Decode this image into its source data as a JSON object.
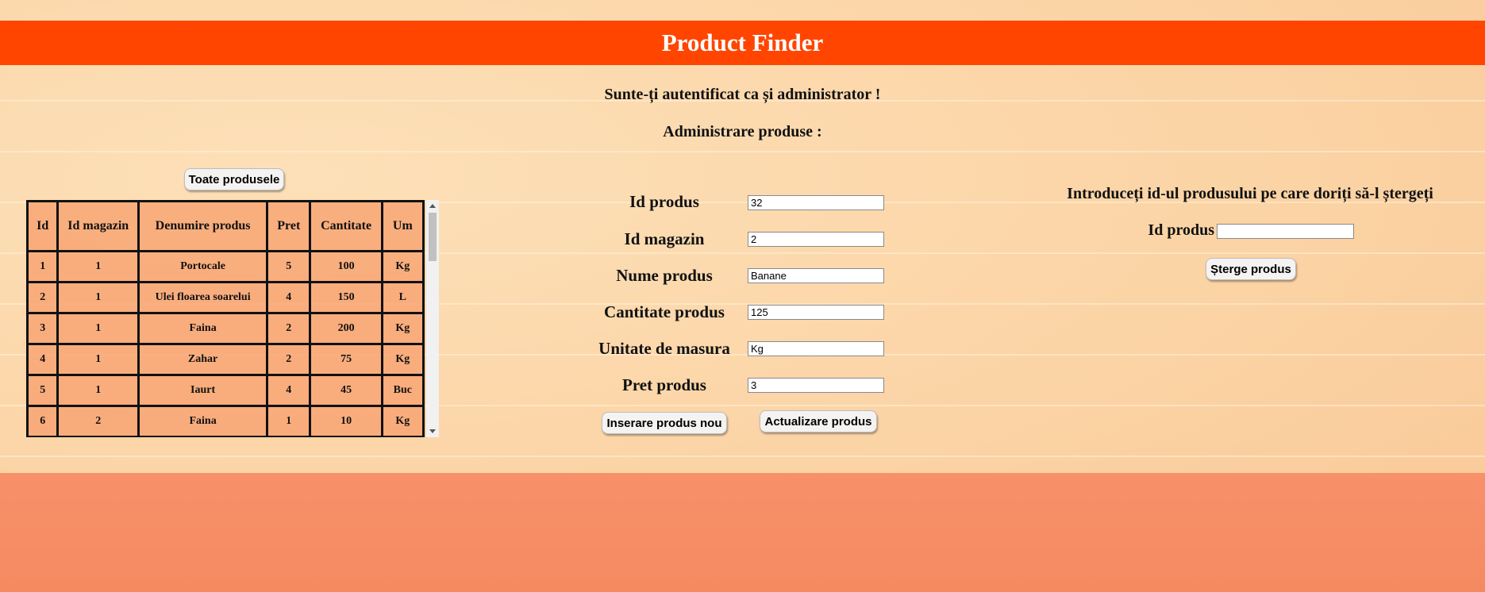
{
  "header": {
    "title": "Product Finder"
  },
  "status": {
    "auth_message": "Sunte-ți autentificat ca și administrator !",
    "section_title": "Administrare produse :"
  },
  "list": {
    "show_all_label": "Toate produsele",
    "columns": [
      "Id",
      "Id magazin",
      "Denumire produs",
      "Pret",
      "Cantitate",
      "Um"
    ],
    "rows": [
      [
        "1",
        "1",
        "Portocale",
        "5",
        "100",
        "Kg"
      ],
      [
        "2",
        "1",
        "Ulei floarea soarelui",
        "4",
        "150",
        "L"
      ],
      [
        "3",
        "1",
        "Faina",
        "2",
        "200",
        "Kg"
      ],
      [
        "4",
        "1",
        "Zahar",
        "2",
        "75",
        "Kg"
      ],
      [
        "5",
        "1",
        "Iaurt",
        "4",
        "45",
        "Buc"
      ],
      [
        "6",
        "2",
        "Faina",
        "1",
        "10",
        "Kg"
      ]
    ]
  },
  "form": {
    "fields": [
      {
        "label": "Id produs",
        "value": "32"
      },
      {
        "label": "Id magazin",
        "value": "2"
      },
      {
        "label": "Nume produs",
        "value": "Banane"
      },
      {
        "label": "Cantitate produs",
        "value": "125"
      },
      {
        "label": "Unitate de masura",
        "value": "Kg"
      },
      {
        "label": "Pret produs",
        "value": "3"
      }
    ],
    "insert_label": "Inserare produs nou",
    "update_label": "Actualizare produs"
  },
  "delete": {
    "prompt": "Introduceți id-ul produsului pe care doriți să-l ștergeți",
    "id_label": "Id produs",
    "id_value": "",
    "button_label": "Șterge produs"
  },
  "colors": {
    "header_bg": "#ff4500",
    "table_cell_bg": "#f7a06e",
    "lower_wall": "#f7916a"
  }
}
